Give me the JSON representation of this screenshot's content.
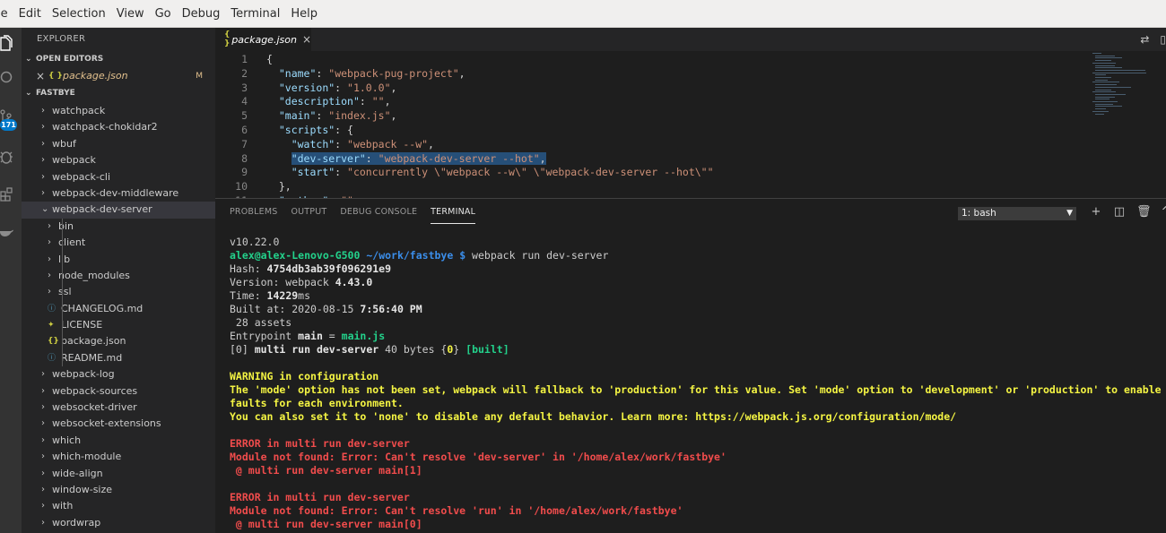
{
  "menu": [
    "le",
    "Edit",
    "Selection",
    "View",
    "Go",
    "Debug",
    "Terminal",
    "Help"
  ],
  "activity": {
    "scm_badge": "171"
  },
  "explorer": {
    "title": "EXPLORER",
    "open_editors_label": "OPEN EDITORS",
    "open_editor": {
      "icon": "{ }",
      "name": "package.json",
      "status": "M"
    },
    "folder_label": "FASTBYE",
    "tree": [
      {
        "label": "watchpack",
        "level": 1,
        "kind": "folder"
      },
      {
        "label": "watchpack-chokidar2",
        "level": 1,
        "kind": "folder"
      },
      {
        "label": "wbuf",
        "level": 1,
        "kind": "folder"
      },
      {
        "label": "webpack",
        "level": 1,
        "kind": "folder"
      },
      {
        "label": "webpack-cli",
        "level": 1,
        "kind": "folder"
      },
      {
        "label": "webpack-dev-middleware",
        "level": 1,
        "kind": "folder"
      },
      {
        "label": "webpack-dev-server",
        "level": 1,
        "kind": "folder-open",
        "selected": true
      },
      {
        "label": "bin",
        "level": 2,
        "kind": "folder"
      },
      {
        "label": "client",
        "level": 2,
        "kind": "folder"
      },
      {
        "label": "lib",
        "level": 2,
        "kind": "folder"
      },
      {
        "label": "node_modules",
        "level": 2,
        "kind": "folder"
      },
      {
        "label": "ssl",
        "level": 2,
        "kind": "folder"
      },
      {
        "label": "CHANGELOG.md",
        "level": 2,
        "kind": "md"
      },
      {
        "label": "LICENSE",
        "level": 2,
        "kind": "license"
      },
      {
        "label": "package.json",
        "level": 2,
        "kind": "json"
      },
      {
        "label": "README.md",
        "level": 2,
        "kind": "info"
      },
      {
        "label": "webpack-log",
        "level": 1,
        "kind": "folder"
      },
      {
        "label": "webpack-sources",
        "level": 1,
        "kind": "folder"
      },
      {
        "label": "websocket-driver",
        "level": 1,
        "kind": "folder"
      },
      {
        "label": "websocket-extensions",
        "level": 1,
        "kind": "folder"
      },
      {
        "label": "which",
        "level": 1,
        "kind": "folder"
      },
      {
        "label": "which-module",
        "level": 1,
        "kind": "folder"
      },
      {
        "label": "wide-align",
        "level": 1,
        "kind": "folder"
      },
      {
        "label": "window-size",
        "level": 1,
        "kind": "folder"
      },
      {
        "label": "with",
        "level": 1,
        "kind": "folder"
      },
      {
        "label": "wordwrap",
        "level": 1,
        "kind": "folder"
      }
    ]
  },
  "editor": {
    "tab": {
      "icon": "{ }",
      "name": "package.json",
      "close": "×"
    },
    "lines": [
      {
        "n": "1",
        "parts": [
          [
            "p",
            "{"
          ]
        ]
      },
      {
        "n": "2",
        "parts": [
          [
            "p",
            "  "
          ],
          [
            "k",
            "\"name\""
          ],
          [
            "p",
            ": "
          ],
          [
            "s",
            "\"webpack-pug-project\""
          ],
          [
            "p",
            ","
          ]
        ]
      },
      {
        "n": "3",
        "parts": [
          [
            "p",
            "  "
          ],
          [
            "k",
            "\"version\""
          ],
          [
            "p",
            ": "
          ],
          [
            "s",
            "\"1.0.0\""
          ],
          [
            "p",
            ","
          ]
        ]
      },
      {
        "n": "4",
        "parts": [
          [
            "p",
            "  "
          ],
          [
            "k",
            "\"description\""
          ],
          [
            "p",
            ": "
          ],
          [
            "s",
            "\"\""
          ],
          [
            "p",
            ","
          ]
        ]
      },
      {
        "n": "5",
        "parts": [
          [
            "p",
            "  "
          ],
          [
            "k",
            "\"main\""
          ],
          [
            "p",
            ": "
          ],
          [
            "s",
            "\"index.js\""
          ],
          [
            "p",
            ","
          ]
        ]
      },
      {
        "n": "6",
        "parts": [
          [
            "p",
            "  "
          ],
          [
            "k",
            "\"scripts\""
          ],
          [
            "p",
            ": {"
          ]
        ]
      },
      {
        "n": "7",
        "parts": [
          [
            "p",
            "    "
          ],
          [
            "k",
            "\"watch\""
          ],
          [
            "p",
            ": "
          ],
          [
            "s",
            "\"webpack --w\""
          ],
          [
            "p",
            ","
          ]
        ]
      },
      {
        "n": "8",
        "parts": [
          [
            "p",
            "    "
          ],
          [
            "k hl",
            "\"dev-server\""
          ],
          [
            "p hl",
            ": "
          ],
          [
            "s hl",
            "\"webpack-dev-server --hot\""
          ],
          [
            "p hl",
            ","
          ]
        ]
      },
      {
        "n": "9",
        "parts": [
          [
            "p",
            "    "
          ],
          [
            "k",
            "\"start\""
          ],
          [
            "p",
            ": "
          ],
          [
            "s",
            "\"concurrently \\\"webpack --w\\\" \\\"webpack-dev-server --hot\\\"\""
          ]
        ]
      },
      {
        "n": "10",
        "parts": [
          [
            "p",
            "  },"
          ]
        ]
      },
      {
        "n": "11",
        "parts": [
          [
            "p",
            "  "
          ],
          [
            "k",
            "\"author\""
          ],
          [
            "p",
            ": "
          ],
          [
            "s",
            "\"\""
          ]
        ]
      }
    ]
  },
  "panel": {
    "tabs": [
      "PROBLEMS",
      "OUTPUT",
      "DEBUG CONSOLE",
      "TERMINAL"
    ],
    "active_tab": "TERMINAL",
    "terminal_select": "1: bash",
    "terminal_lines": [
      [
        [
          "",
          "v10.22.0"
        ]
      ],
      [
        [
          "green b",
          "alex@alex-Lenovo-G500"
        ],
        [
          "",
          " "
        ],
        [
          "blue b",
          "~/work/fastbye $"
        ],
        [
          "",
          " webpack run dev-server"
        ]
      ],
      [
        [
          "",
          "Hash: "
        ],
        [
          "b white",
          "4754db3ab39f096291e9"
        ]
      ],
      [
        [
          "",
          "Version: webpack "
        ],
        [
          "b white",
          "4.43.0"
        ]
      ],
      [
        [
          "",
          "Time: "
        ],
        [
          "b white",
          "14229"
        ],
        [
          "",
          "ms"
        ]
      ],
      [
        [
          "",
          "Built at: 2020-08-15 "
        ],
        [
          "b white",
          "7:56:40 PM"
        ]
      ],
      [
        [
          "",
          " 28 assets"
        ]
      ],
      [
        [
          "",
          "Entrypoint "
        ],
        [
          "b white",
          "main"
        ],
        [
          "",
          " = "
        ],
        [
          "green b",
          "main.js"
        ]
      ],
      [
        [
          "",
          "[0] "
        ],
        [
          "b white",
          "multi run dev-server"
        ],
        [
          "",
          " 40 bytes {"
        ],
        [
          "yellow b",
          "0"
        ],
        [
          "",
          "} "
        ],
        [
          "green b",
          "[built]"
        ]
      ],
      [
        [
          "",
          ""
        ]
      ],
      [
        [
          "yellow b",
          "WARNING in configuration"
        ]
      ],
      [
        [
          "yellow b",
          "The 'mode' option has not been set, webpack will fallback to 'production' for this value. Set 'mode' option to 'development' or 'production' to enable de"
        ]
      ],
      [
        [
          "yellow b",
          "faults for each environment."
        ]
      ],
      [
        [
          "yellow b",
          "You can also set it to 'none' to disable any default behavior. Learn more: https://webpack.js.org/configuration/mode/"
        ]
      ],
      [
        [
          "",
          ""
        ]
      ],
      [
        [
          "red b",
          "ERROR in multi run dev-server"
        ]
      ],
      [
        [
          "red b",
          "Module not found: Error: Can't resolve 'dev-server' in '/home/alex/work/fastbye'"
        ]
      ],
      [
        [
          "red b",
          " @ multi run dev-server main[1]"
        ]
      ],
      [
        [
          "",
          ""
        ]
      ],
      [
        [
          "red b",
          "ERROR in multi run dev-server"
        ]
      ],
      [
        [
          "red b",
          "Module not found: Error: Can't resolve 'run' in '/home/alex/work/fastbye'"
        ]
      ],
      [
        [
          "red b",
          " @ multi run dev-server main[0]"
        ]
      ]
    ]
  }
}
